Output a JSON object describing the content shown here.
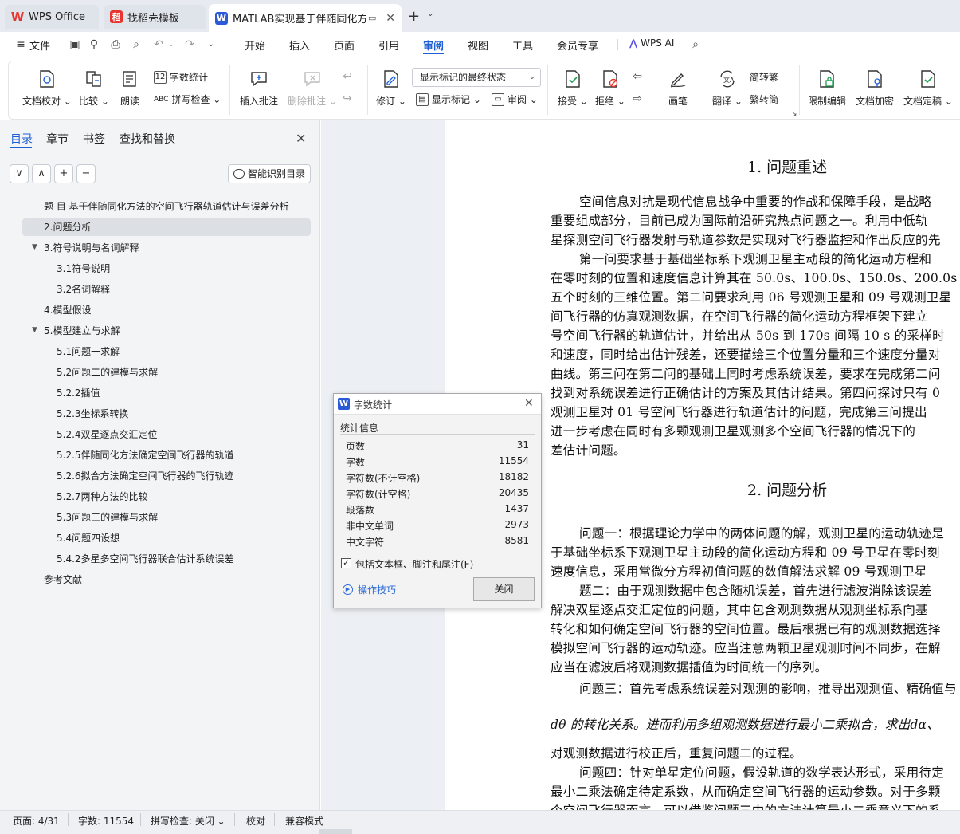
{
  "tabs": [
    {
      "label": "WPS Office",
      "icon": "wps-logo-icon"
    },
    {
      "label": "找稻壳模板",
      "icon": "docer-logo-icon"
    },
    {
      "label": "MATLAB实现基于伴随同化方",
      "icon": "wps-writer-icon"
    }
  ],
  "menu": {
    "file": "文件",
    "items": [
      "开始",
      "插入",
      "页面",
      "引用",
      "审阅",
      "视图",
      "工具",
      "会员专享"
    ],
    "active": "审阅",
    "wps_ai": "WPS AI"
  },
  "ribbon": {
    "proofread": "文档校对",
    "compare": "比较",
    "read_aloud": "朗读",
    "word_count": "字数统计",
    "spell_check": "拼写检查",
    "insert_comment": "插入批注",
    "delete_comment": "删除批注",
    "track_changes": "修订",
    "display_state": "显示标记的最终状态",
    "show_markup": "显示标记",
    "review_pane": "审阅",
    "accept": "接受",
    "reject": "拒绝",
    "pen": "画笔",
    "translate": "翻译",
    "to_traditional": "简转繁",
    "to_simplified": "繁转简",
    "restrict_edit": "限制编辑",
    "encrypt": "文档加密",
    "finalize": "文档定稿"
  },
  "nav": {
    "tabs": [
      "目录",
      "章节",
      "书签",
      "查找和替换"
    ],
    "smart_toc": "智能识别目录",
    "controls": [
      "∨",
      "∧",
      "+",
      "−"
    ],
    "toc": [
      {
        "label": "题 目 基于伴随同化方法的空间飞行器轨道估计与误差分析",
        "level": 0
      },
      {
        "label": "2.问题分析",
        "level": 0,
        "selected": true
      },
      {
        "label": "3.符号说明与名词解释",
        "level": 0,
        "expanded": true
      },
      {
        "label": "3.1符号说明",
        "level": 1
      },
      {
        "label": "3.2名词解释",
        "level": 1
      },
      {
        "label": "4.模型假设",
        "level": 0
      },
      {
        "label": "5.模型建立与求解",
        "level": 0,
        "expanded": true
      },
      {
        "label": "5.1问题一求解",
        "level": 1
      },
      {
        "label": "5.2问题二的建模与求解",
        "level": 1
      },
      {
        "label": "5.2.2插值",
        "level": 1
      },
      {
        "label": "5.2.3坐标系转换",
        "level": 1
      },
      {
        "label": "5.2.4双星逐点交汇定位",
        "level": 1
      },
      {
        "label": "5.2.5伴随同化方法确定空间飞行器的轨道",
        "level": 1
      },
      {
        "label": "5.2.6拟合方法确定空间飞行器的飞行轨迹",
        "level": 1
      },
      {
        "label": "5.2.7两种方法的比较",
        "level": 1
      },
      {
        "label": "5.3问题三的建模与求解",
        "level": 1
      },
      {
        "label": "5.4问题四设想",
        "level": 1
      },
      {
        "label": "5.4.2多星多空间飞行器联合估计系统误差",
        "level": 1
      },
      {
        "label": "参考文献",
        "level": 0
      }
    ]
  },
  "document": {
    "heading1": "1.  问题重述",
    "heading2": "2.  问题分析",
    "lines1": [
      "空间信息对抗是现代信息战争中重要的作战和保障手段，是战略",
      "重要组成部分，目前已成为国际前沿研究热点问题之一。利用中低轨",
      "星探测空间飞行器发射与轨道参数是实现对飞行器监控和作出反应的先",
      "第一问要求基于基础坐标系下观测卫星主动段的简化运动方程和",
      "在零时刻的位置和速度信息计算其在 50.0s、100.0s、150.0s、200.0s",
      "五个时刻的三维位置。第二问要求利用 06 号观测卫星和 09 号观测卫星",
      "间飞行器的仿真观测数据，在空间飞行器的简化运动方程框架下建立",
      "号空间飞行器的轨道估计，并给出从 50s 到 170s 间隔 10 s 的采样时",
      "和速度，同时给出估计残差，还要描绘三个位置分量和三个速度分量对",
      "曲线。第三问在第二问的基础上同时考虑系统误差，要求在完成第二问",
      "找到对系统误差进行正确估计的方案及其估计结果。第四问探讨只有 0",
      "观测卫星对 01 号空间飞行器进行轨道估计的问题，完成第三问提出",
      "进一步考虑在同时有多颗观测卫星观测多个空间飞行器的情况下的",
      "差估计问题。"
    ],
    "lines2": [
      "问题一：根据理论力学中的两体问题的解，观测卫星的运动轨迹是",
      "于基础坐标系下观测卫星主动段的简化运动方程和 09 号卫星在零时刻",
      "速度信息，采用常微分方程初值问题的数值解法求解 09 号观测卫星",
      "题二：由于观测数据中包含随机误差，首先进行滤波消除该误差",
      "解决双星逐点交汇定位的问题，其中包含观测数据从观测坐标系向基",
      "转化和如何确定空间飞行器的空间位置。最后根据已有的观测数据选择",
      "模拟空间飞行器的运动轨迹。应当注意两颗卫星观测时间不同步，在解",
      "应当在滤波后将观测数据插值为时间统一的序列。",
      "问题三：首先考虑系统误差对观测的影响，推导出观测值、精确值与",
      "dθ 的转化关系。进而利用多组观测数据进行最小二乘拟合，求出dα、",
      "对观测数据进行校正后，重复问题二的过程。",
      "问题四：针对单星定位问题，假设轨道的数学表达形式，采用待定",
      "最小二乘法确定待定系数，从而确定空间飞行器的运动参数。对于多颗",
      "个空间飞行器而言，可以借鉴问题三中的方法计算最小二乘意义下的系"
    ]
  },
  "dialog": {
    "title": "字数统计",
    "section": "统计信息",
    "stats": [
      {
        "label": "页数",
        "value": "31"
      },
      {
        "label": "字数",
        "value": "11554"
      },
      {
        "label": "字符数(不计空格)",
        "value": "18182"
      },
      {
        "label": "字符数(计空格)",
        "value": "20435"
      },
      {
        "label": "段落数",
        "value": "1437"
      },
      {
        "label": "非中文单词",
        "value": "2973"
      },
      {
        "label": "中文字符",
        "value": "8581"
      }
    ],
    "checkbox_label": "包括文本框、脚注和尾注(F)",
    "checkbox_checked": true,
    "tips": "操作技巧",
    "close": "关闭"
  },
  "statusbar": {
    "page": "页面: 4/31",
    "words": "字数: 11554",
    "spell": "拼写检查: 关闭",
    "proof": "校对",
    "compat": "兼容模式"
  },
  "colors": {
    "accent": "#1f5fd6",
    "wps_red": "#e8342e",
    "nav_bg": "#f3f4f6"
  }
}
